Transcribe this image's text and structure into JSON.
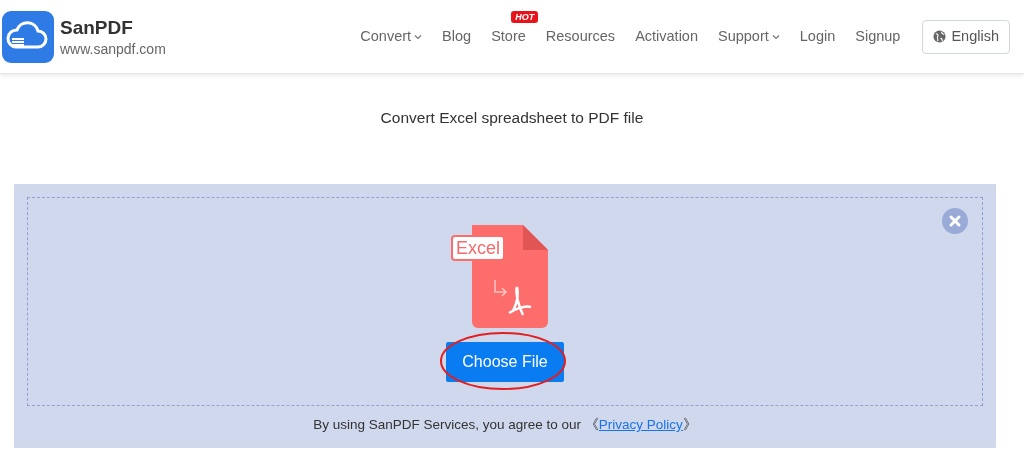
{
  "brand": {
    "name": "SanPDF",
    "url": "www.sanpdf.com"
  },
  "nav": [
    {
      "label": "Convert",
      "dropdown": true
    },
    {
      "label": "Blog",
      "dropdown": false
    },
    {
      "label": "Store",
      "dropdown": false,
      "badge": "HOT"
    },
    {
      "label": "Resources",
      "dropdown": false
    },
    {
      "label": "Activation",
      "dropdown": false
    },
    {
      "label": "Support",
      "dropdown": true
    },
    {
      "label": "Login",
      "dropdown": false
    },
    {
      "label": "Signup",
      "dropdown": false
    }
  ],
  "language_button": "English",
  "heading": "Convert Excel spreadsheet to PDF file",
  "upload": {
    "file_label": "Excel",
    "button": "Choose File",
    "highlight_ring": true
  },
  "footer": {
    "text": "By using SanPDF Services, you agree to our ",
    "link_prefix": "《",
    "link": "Privacy Policy",
    "link_suffix": "》"
  }
}
